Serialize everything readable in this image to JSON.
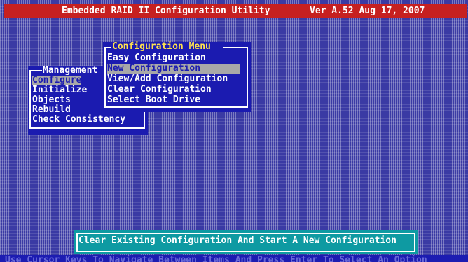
{
  "title_bar": {
    "title": "Embedded RAID II Configuration Utility",
    "version": "Ver A.52 Aug 17, 2007"
  },
  "management_menu": {
    "caption": "Management",
    "items": [
      {
        "label": "Configure",
        "selected": true
      },
      {
        "label": "Initialize",
        "selected": false
      },
      {
        "label": "Objects",
        "selected": false
      },
      {
        "label": "Rebuild",
        "selected": false
      },
      {
        "label": "Check Consistency",
        "selected": false
      }
    ]
  },
  "configuration_menu": {
    "caption": "Configuration Menu",
    "items": [
      {
        "label": "Easy Configuration",
        "selected": false
      },
      {
        "label": "New Configuration",
        "selected": true
      },
      {
        "label": "View/Add Configuration",
        "selected": false
      },
      {
        "label": "Clear Configuration",
        "selected": false
      },
      {
        "label": "Select Boot Drive",
        "selected": false
      }
    ]
  },
  "status_message": "Clear Existing Configuration And Start A New Configuration",
  "help_line": "Use Cursor Keys To Navigate Between Items And Press Enter To Select An Option",
  "colors": {
    "background": "#3a3aa4",
    "title_bar": "#c62020",
    "menu": "#1b1bb0",
    "highlight": "#a8a8a8",
    "caption_accent": "#ffe24d",
    "status_box": "#0e9aa2"
  }
}
